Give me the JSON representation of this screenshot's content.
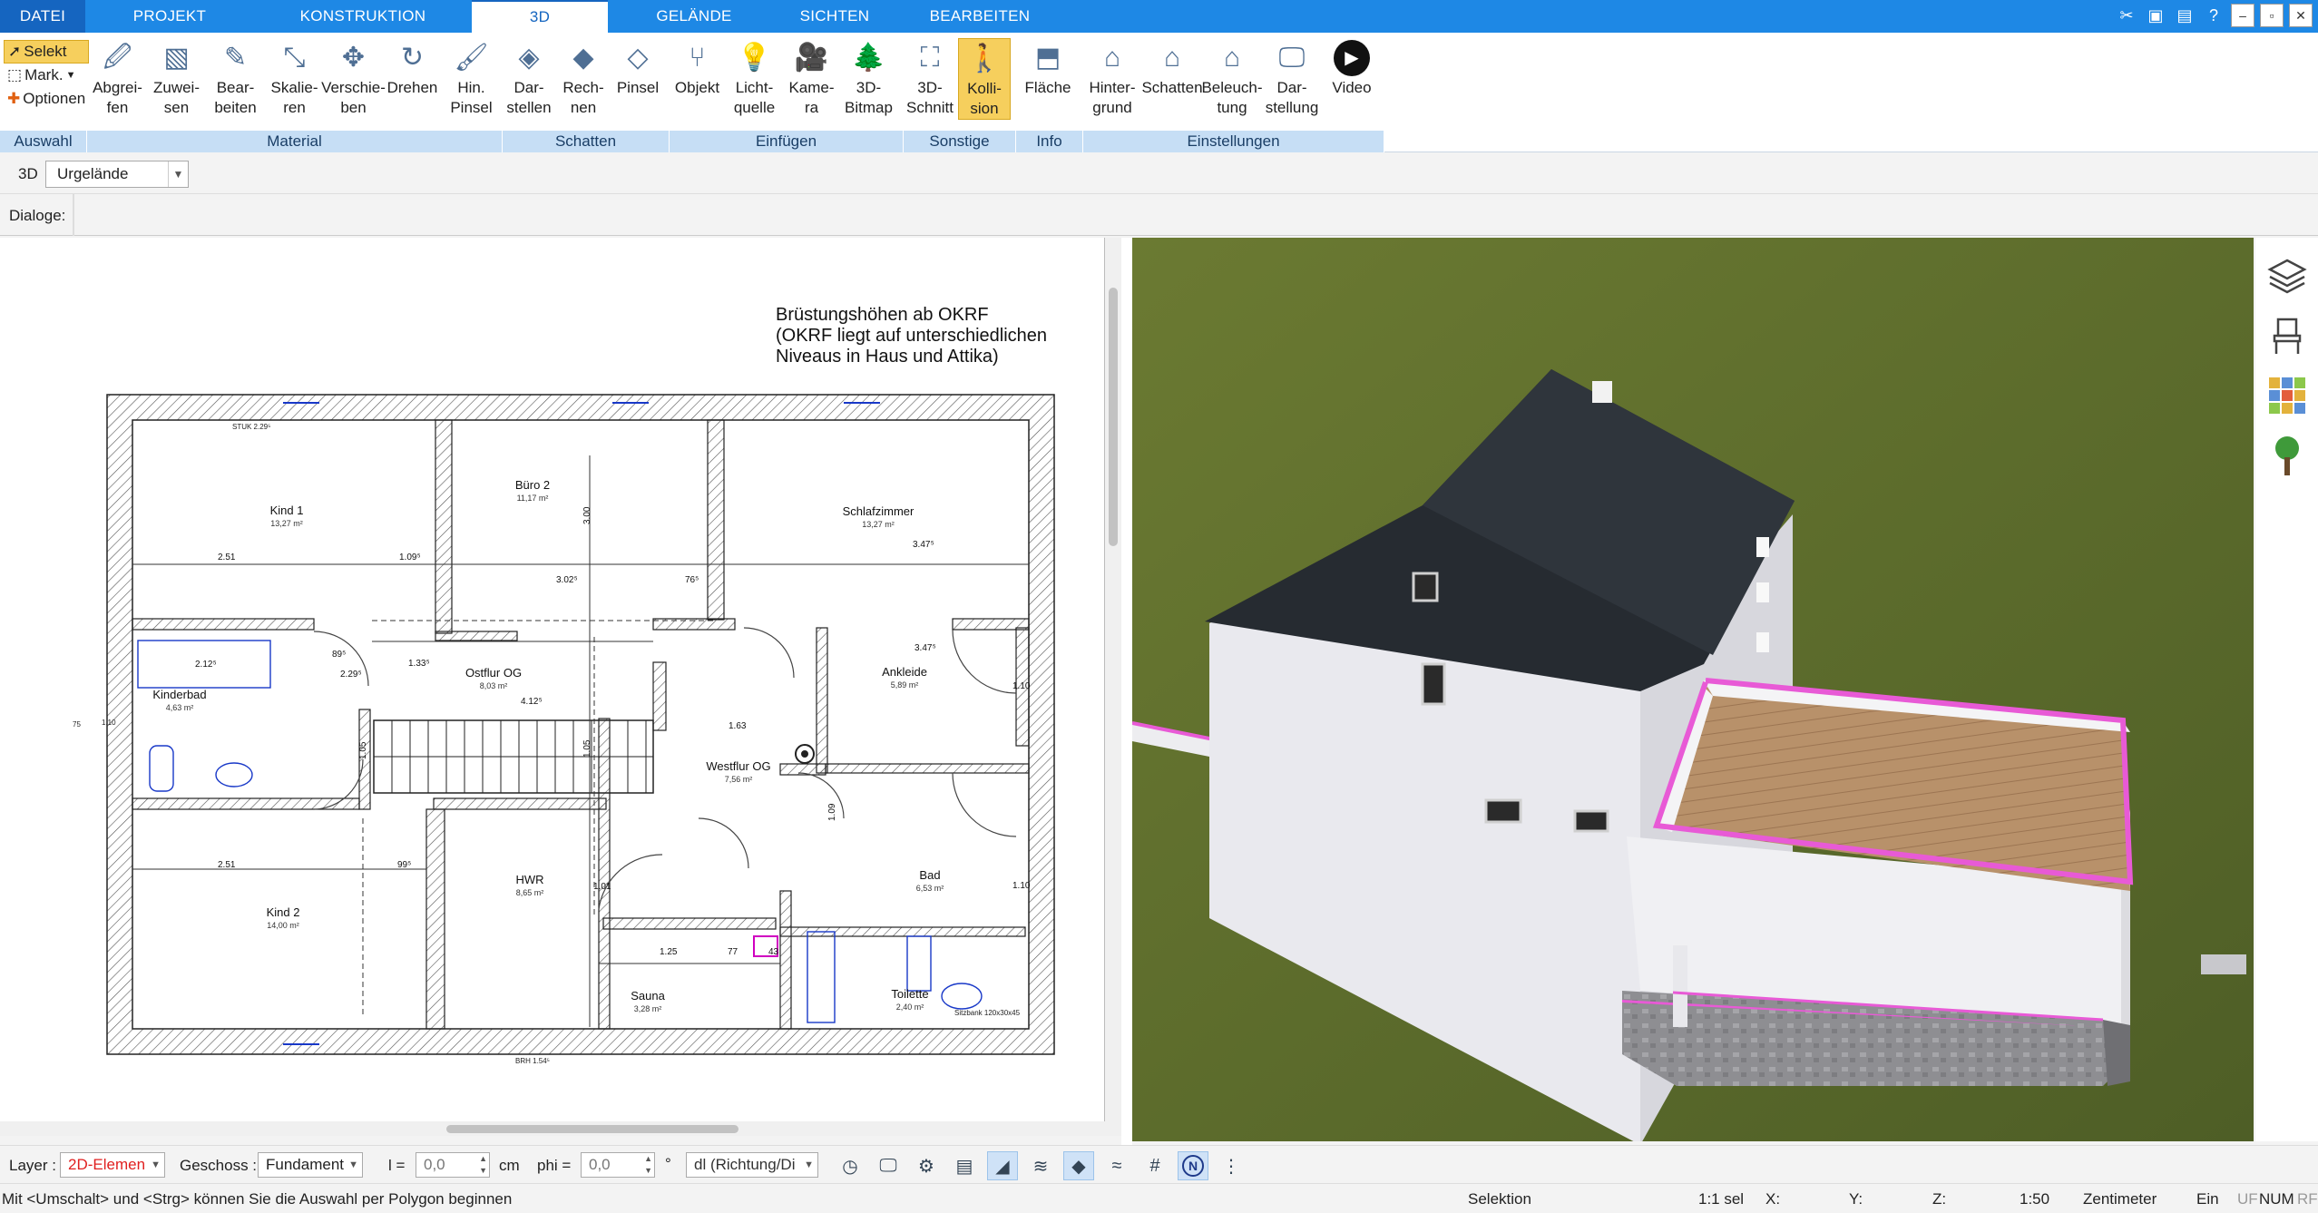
{
  "menu": {
    "tabs": [
      "DATEI",
      "PROJEKT",
      "KONSTRUKTION",
      "3D",
      "GELÄNDE",
      "SICHTEN",
      "BEARBEITEN"
    ],
    "active": "3D"
  },
  "ribbon": {
    "auswahl": {
      "label": "Auswahl",
      "selekt": "Selekt",
      "mark": "Mark.",
      "optionen": "Optionen"
    },
    "material": {
      "label": "Material",
      "buttons": [
        [
          "Abgrei-",
          "fen"
        ],
        [
          "Zuwei-",
          "sen"
        ],
        [
          "Bear-",
          "beiten"
        ],
        [
          "Skalie-",
          "ren"
        ],
        [
          "Verschie-",
          "ben"
        ],
        [
          "Drehen",
          ""
        ],
        [
          "Hin.",
          "Pinsel"
        ]
      ]
    },
    "schatten": {
      "label": "Schatten",
      "buttons": [
        [
          "Dar-",
          "stellen"
        ],
        [
          "Rech-",
          "nen"
        ],
        [
          "Pinsel",
          ""
        ]
      ]
    },
    "einfuegen": {
      "label": "Einfügen",
      "buttons": [
        [
          "Objekt",
          ""
        ],
        [
          "Licht-",
          "quelle"
        ],
        [
          "Kame-",
          "ra"
        ],
        [
          "3D-",
          "Bitmap"
        ]
      ]
    },
    "sonstige": {
      "label": "Sonstige",
      "buttons": [
        [
          "3D-",
          "Schnitt"
        ],
        [
          "Kolli-",
          "sion"
        ]
      ]
    },
    "info": {
      "label": "Info",
      "buttons": [
        [
          "Fläche",
          ""
        ]
      ]
    },
    "einstellungen": {
      "label": "Einstellungen",
      "buttons": [
        [
          "Hinter-",
          "grund"
        ],
        [
          "Schatten",
          ""
        ],
        [
          "Beleuch-",
          "tung"
        ],
        [
          "Dar-",
          "stellung"
        ],
        [
          "Video",
          ""
        ]
      ]
    }
  },
  "row2": {
    "mode": "3D",
    "combo": "Urgelände"
  },
  "row3": {
    "label": "Dialoge:"
  },
  "plan": {
    "note": [
      "Brüstungshöhen ab OKRF",
      "(OKRF liegt auf unterschiedlichen",
      "Niveaus in Haus und Attika)"
    ],
    "rooms": [
      {
        "name": "Kind 1",
        "area": "13,27 m²"
      },
      {
        "name": "Büro 2",
        "area": "11,17 m²"
      },
      {
        "name": "Schlafzimmer",
        "area": "13,27 m²"
      },
      {
        "name": "Kinderbad",
        "area": "4,63 m²"
      },
      {
        "name": "Ostflur OG",
        "area": "8,03 m²"
      },
      {
        "name": "Ankleide",
        "area": "5,89 m²"
      },
      {
        "name": "Westflur OG",
        "area": "7,56 m²"
      },
      {
        "name": "Kind 2",
        "area": "14,00 m²"
      },
      {
        "name": "HWR",
        "area": "8,65 m²"
      },
      {
        "name": "Bad",
        "area": "6,53 m²"
      },
      {
        "name": "Sauna",
        "area": "3,28 m²"
      },
      {
        "name": "Toilette",
        "area": "2,40 m²"
      }
    ],
    "dims": [
      "2.51",
      "1.09⁵",
      "3.02⁵",
      "76⁵",
      "3.47⁵",
      "3.47⁵",
      "1.33⁵",
      "4.12⁵",
      "1.63",
      "2.51",
      "99⁵",
      "1.25",
      "77",
      "1.10",
      "1.10",
      "3.00",
      "1.05",
      "1.05",
      "1.09",
      "2.12⁵",
      "2.29⁵",
      "89⁵",
      "1.01",
      "43"
    ],
    "small": [
      "STUK 2.29⁵",
      "Sitzbank 120x30x45",
      "BRH 1.54⁵",
      "1.10",
      "75"
    ]
  },
  "bottom": {
    "layer_label": "Layer :",
    "layer_value": "2D-Elemen",
    "geschoss_label": "Geschoss :",
    "geschoss_value": "Fundament",
    "l_label": "l =",
    "l_value": "0,0",
    "l_unit": "cm",
    "phi_label": "phi =",
    "phi_value": "0,0",
    "phi_unit": "°",
    "dl_value": "dl (Richtung/Di"
  },
  "status": {
    "hint": "Mit <Umschalt> und <Strg> können Sie die Auswahl per Polygon beginnen",
    "mode": "Selektion",
    "sel": "1:1 sel",
    "x": "X:",
    "y": "Y:",
    "z": "Z:",
    "scale": "1:50",
    "unit": "Zentimeter",
    "ein": "Ein",
    "uf": "UF",
    "num": "NUM",
    "rf": "RF"
  },
  "colors": {
    "accent": "#1e88e5",
    "ribbon_group": "#c6def5",
    "highlight": "#f6cf5d",
    "grass": "#5a6a2d",
    "roof": "#262b31",
    "wall": "#e9e9ee",
    "deck": "#b8916a",
    "pink": "#e85ad6"
  }
}
